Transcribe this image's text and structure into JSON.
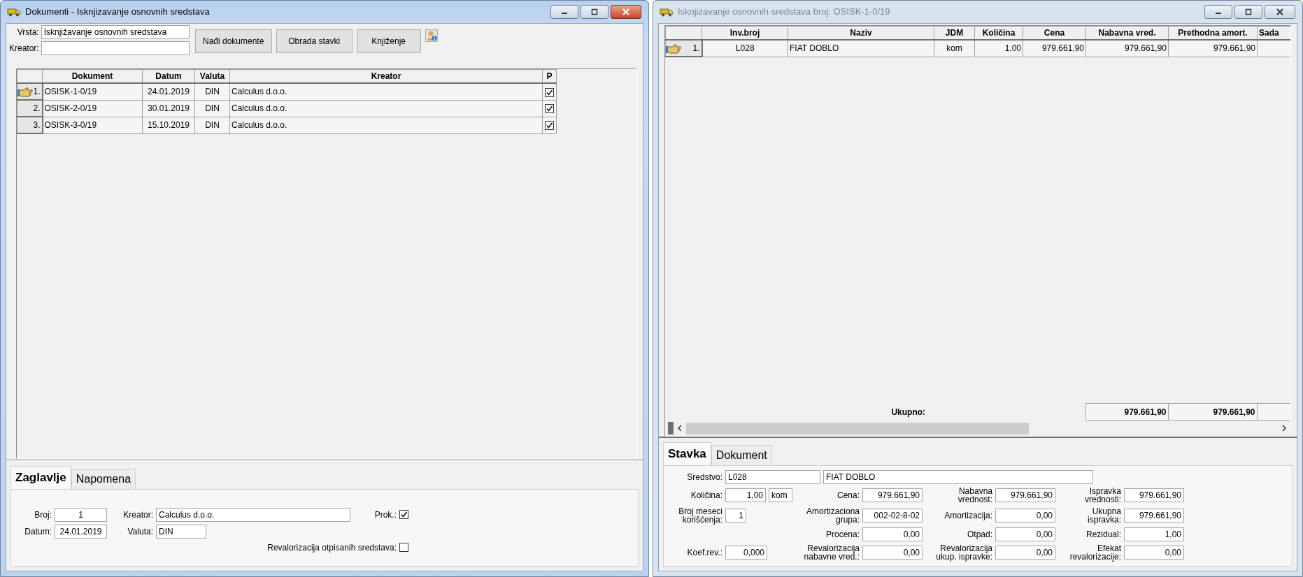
{
  "left_window": {
    "title": "Dokumenti - Isknjizavanje osnovnih sredstava",
    "active": true,
    "filters": [
      {
        "label": "Vrsta:",
        "value": "Isknjižavanje osnovnih sredstava"
      },
      {
        "label": "Kreator:"
      }
    ],
    "buttons": [
      "Nađi dokumente",
      "Obrada stavki",
      "Knjiženje"
    ],
    "table": {
      "columns": [
        "Dokument",
        "Datum",
        "Valuta",
        "Kreator",
        "P"
      ],
      "rows": [
        {
          "number": "1.",
          "selected": true,
          "cells": [
            "OSISK-1-0/19",
            "24.01.2019",
            "DIN",
            "Calculus d.o.o."
          ],
          "p": true
        },
        {
          "number": "2.",
          "selected": false,
          "cells": [
            "OSISK-2-0/19",
            "30.01.2019",
            "DIN",
            "Calculus d.o.o."
          ],
          "p": true
        },
        {
          "number": "3.",
          "selected": false,
          "cells": [
            "OSISK-3-0/19",
            "15.10.2019",
            "DIN",
            "Calculus d.o.o."
          ],
          "p": true
        }
      ]
    },
    "tabs": [
      {
        "label": "Zaglavlje",
        "selected": true
      },
      {
        "label": "Napomena",
        "selected": false
      }
    ],
    "form": {
      "broj": {
        "label": "Broj:",
        "value": "1"
      },
      "kreator": {
        "label": "Kreator:",
        "value": "Calculus d.o.o."
      },
      "prok": {
        "label": "Prok.:",
        "checked": true
      },
      "datum": {
        "label": "Datum:",
        "value": "24.01.2019"
      },
      "valuta": {
        "label": "Valuta:",
        "value": "DIN"
      },
      "revalorizacija": {
        "label": "Revalorizacija otpisanih sredstava:",
        "checked": false
      }
    }
  },
  "right_window": {
    "title": "Isknjizavanje osnovnih sredstava broj: OSISK-1-0/19",
    "active": false,
    "table": {
      "columns": [
        "Inv.broj",
        "Naziv",
        "JDM",
        "Količina",
        "Cena",
        "Nabavna vred.",
        "Prethodna amort.",
        "Sada"
      ],
      "rows": [
        {
          "number": "1.",
          "selected": true,
          "cells": [
            "L028",
            "FIAT DOBLO",
            "kom",
            "1,00",
            "979.661,90",
            "979.661,90",
            "979.661,90"
          ]
        }
      ],
      "total_label": "Ukupno:",
      "totals": [
        "979.661,90",
        "979.661,90"
      ]
    },
    "tabs": [
      {
        "label": "Stavka",
        "selected": true
      },
      {
        "label": "Dokument",
        "selected": false
      }
    ],
    "sredstvo": {
      "label": "Sredstvo:",
      "code": "L028",
      "name": "FIAT DOBLO"
    },
    "field_rows": [
      [
        {
          "label": "Količina:",
          "values": [
            "1,00",
            "kom"
          ]
        },
        {
          "label": "Cena:",
          "values": [
            "979.661,90"
          ]
        },
        {
          "label": "Nabavna vrednost:",
          "values": [
            "979.661,90"
          ]
        },
        {
          "label": "Ispravka vrednosti:",
          "values": [
            "979.661,90"
          ]
        }
      ],
      [
        {
          "label": "Broj meseci korišćenja:",
          "values": [
            "1"
          ]
        },
        {
          "label": "Amortizaciona grupa:",
          "values": [
            "002-02-8-02"
          ]
        },
        {
          "label": "Amortizacija:",
          "values": [
            "0,00"
          ]
        },
        {
          "label": "Ukupna ispravka:",
          "values": [
            "979.661,90"
          ]
        }
      ],
      [
        null,
        {
          "label": "Procena:",
          "values": [
            "0,00"
          ]
        },
        {
          "label": "Otpad:",
          "values": [
            "0,00"
          ]
        },
        {
          "label": "Rezidual:",
          "values": [
            "1,00"
          ]
        }
      ],
      [
        {
          "label": "Koef.rev.:",
          "values": [
            "0,000"
          ]
        },
        {
          "label": "Revalorizacija nabavne vred.:",
          "values": [
            "0,00"
          ]
        },
        {
          "label": "Revalorizacija ukup. ispravke:",
          "values": [
            "0,00"
          ]
        },
        {
          "label": "Efekat revalorizacije:",
          "values": [
            "0,00"
          ]
        }
      ]
    ]
  }
}
